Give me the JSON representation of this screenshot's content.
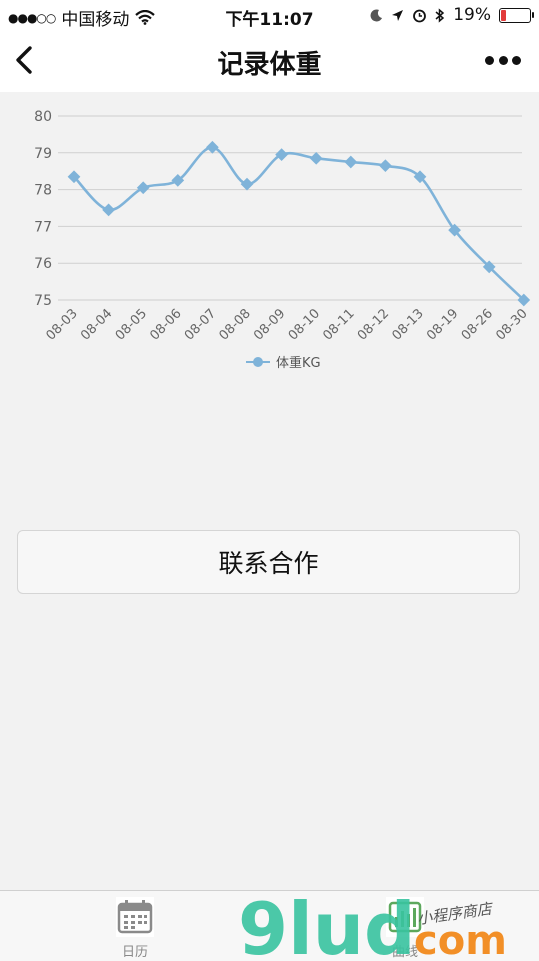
{
  "status_bar": {
    "carrier": "中国移动",
    "time": "下午11:07",
    "battery": "19%",
    "battery_level": 0.19
  },
  "nav": {
    "title": "记录体重"
  },
  "chart_data": {
    "type": "line",
    "categories": [
      "08-03",
      "08-04",
      "08-05",
      "08-06",
      "08-07",
      "08-08",
      "08-09",
      "08-10",
      "08-11",
      "08-12",
      "08-13",
      "08-19",
      "08-26",
      "08-30"
    ],
    "series": [
      {
        "name": "体重KG",
        "values": [
          78.35,
          77.45,
          78.05,
          78.25,
          79.15,
          78.15,
          78.95,
          78.85,
          78.75,
          78.65,
          78.35,
          76.9,
          75.9,
          75.0
        ],
        "color": "#7fb3d9"
      }
    ],
    "yticks": [
      80,
      79,
      78,
      77,
      76,
      75
    ],
    "ylim": [
      75,
      80
    ],
    "legend": "bottom-center",
    "grid": true
  },
  "contact_button": {
    "label": "联系合作"
  },
  "tabbar": {
    "items": [
      {
        "label": "日历",
        "icon": "calendar-icon"
      },
      {
        "label": "曲线",
        "icon": "chart-icon"
      }
    ]
  },
  "watermark": {
    "text_main": "9lud",
    "text_com": "com",
    "text_sub": "小程序商店"
  }
}
